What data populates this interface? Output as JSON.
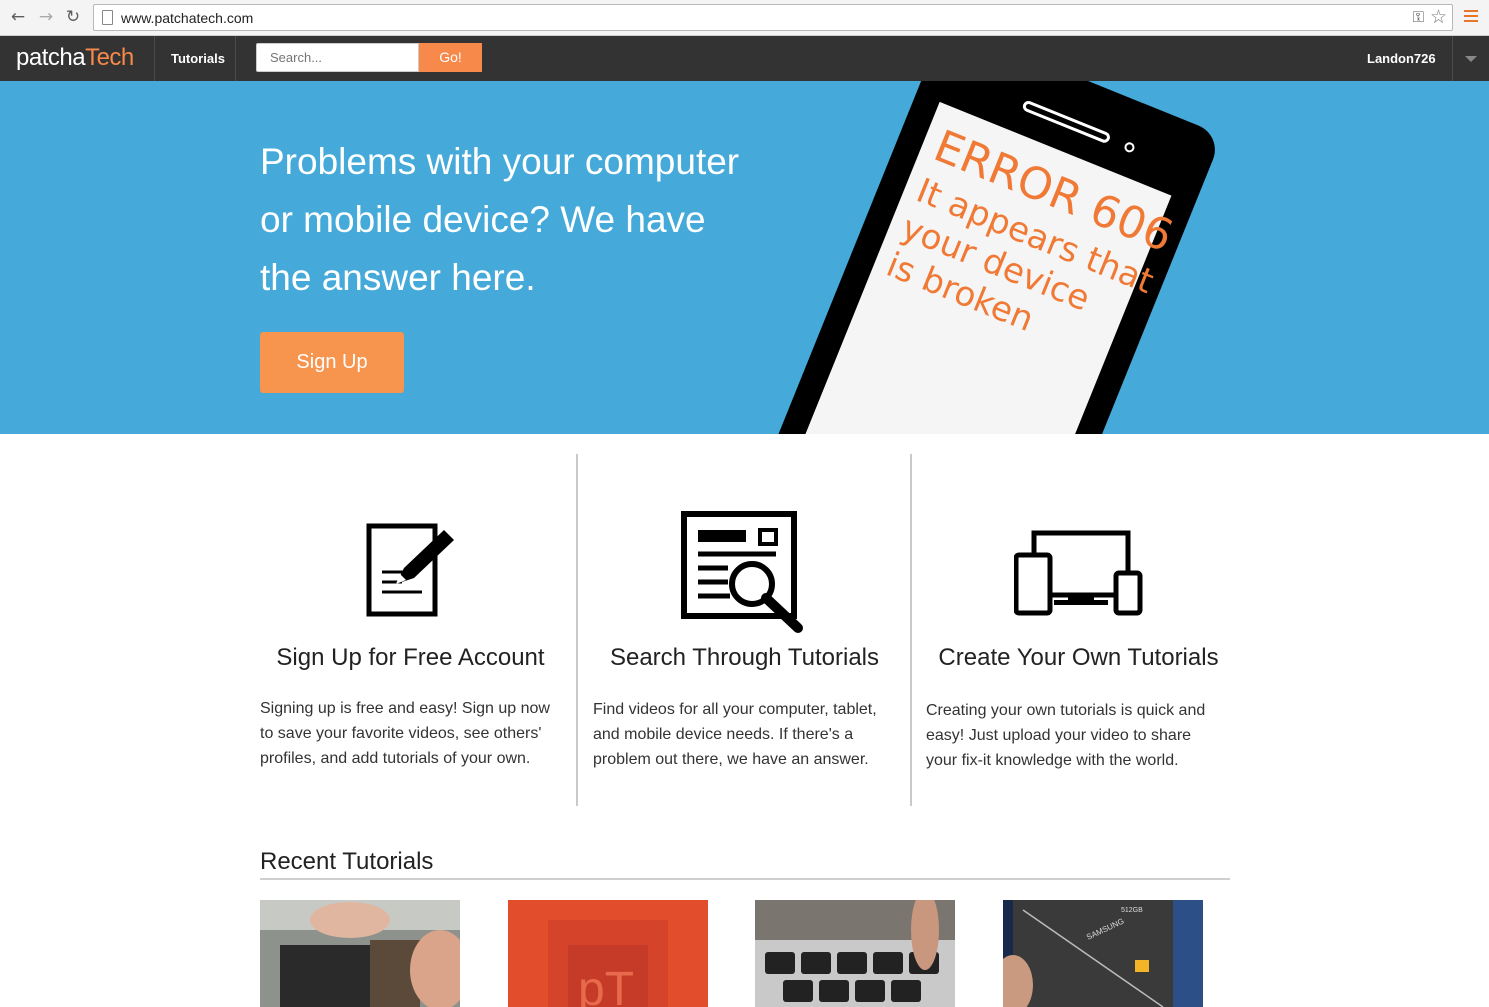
{
  "browser": {
    "url": "www.patchatech.com",
    "colors": {
      "menu_icon": "#e8762b"
    }
  },
  "nav": {
    "logo_part1": "patcha",
    "logo_part2": "Tech",
    "tutorials": "Tutorials",
    "search_placeholder": "Search...",
    "search_button": "Go!",
    "username": "Landon726",
    "colors": {
      "bar": "#333333",
      "accent": "#f7894a"
    }
  },
  "hero": {
    "title": "Problems with your computer or mobile device? We have the answer here.",
    "signup_button": "Sign Up",
    "phone_screen": {
      "line1": "ERROR 606",
      "line2": "It appears that",
      "line3": "your device",
      "line4": "is broken"
    },
    "colors": {
      "background": "#45a9d9",
      "button": "#f7944e",
      "error_text": "#f07a35"
    }
  },
  "features": [
    {
      "icon": "edit-document-icon",
      "title": "Sign Up for Free Account",
      "text": "Signing up is free and easy! Sign up now to save your favorite videos, see others' profiles, and add tutorials of your own."
    },
    {
      "icon": "search-document-icon",
      "title": "Search Through Tutorials",
      "text": "Find videos for all your computer, tablet, and mobile device needs. If there's a problem out there, we have an answer."
    },
    {
      "icon": "devices-icon",
      "title": "Create Your Own Tutorials",
      "text": "Creating your own tutorials is quick and easy! Just upload your video to share your fix-it knowledge with the world."
    }
  ],
  "recent": {
    "title": "Recent Tutorials",
    "thumbnails": [
      {
        "subject": "phone-battery-repair"
      },
      {
        "subject": "patchatech-logo",
        "logo_text": "pT"
      },
      {
        "subject": "laptop-keyboard"
      },
      {
        "subject": "samsung-ssd",
        "brand_text": "SAMSUNG",
        "capacity_text": "512GB"
      }
    ]
  }
}
